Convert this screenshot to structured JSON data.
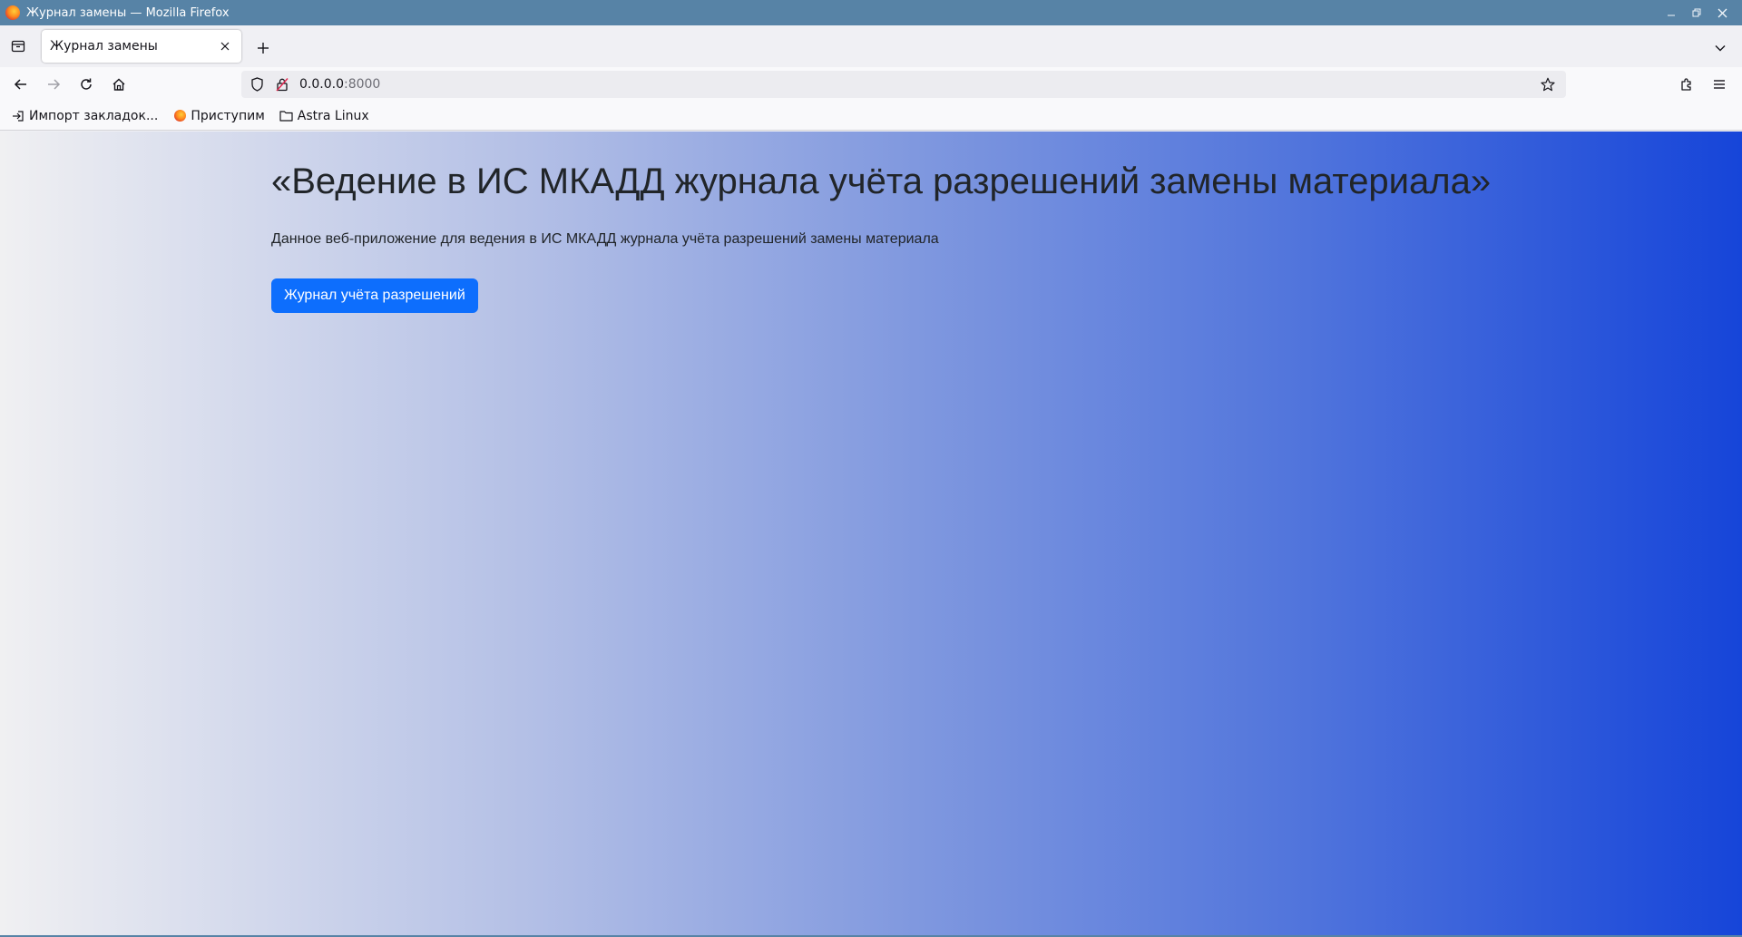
{
  "window": {
    "title": "Журнал замены — Mozilla Firefox",
    "controls": [
      "minimize",
      "restore",
      "close"
    ]
  },
  "tabs": [
    {
      "label": "Журнал замены",
      "active": true
    }
  ],
  "toolbar": {
    "url_host": "0.0.0.0",
    "url_port": ":8000"
  },
  "bookmarks": [
    {
      "label": "Импорт закладок...",
      "icon": "import-icon"
    },
    {
      "label": "Приступим",
      "icon": "firefox-icon"
    },
    {
      "label": "Astra Linux",
      "icon": "folder-icon"
    }
  ],
  "page": {
    "heading": "«Ведение в ИС МКАДД журнала учёта разрешений замены материала»",
    "description": "Данное веб-приложение для ведения в ИС МКАДД журнала учёта разрешений замены материала",
    "button_label": "Журнал учёта разрешений"
  },
  "colors": {
    "titlebar": "#5783a6",
    "button": "#0d6efd",
    "gradient_start": "#f0f0f2",
    "gradient_end": "#1645d9"
  }
}
